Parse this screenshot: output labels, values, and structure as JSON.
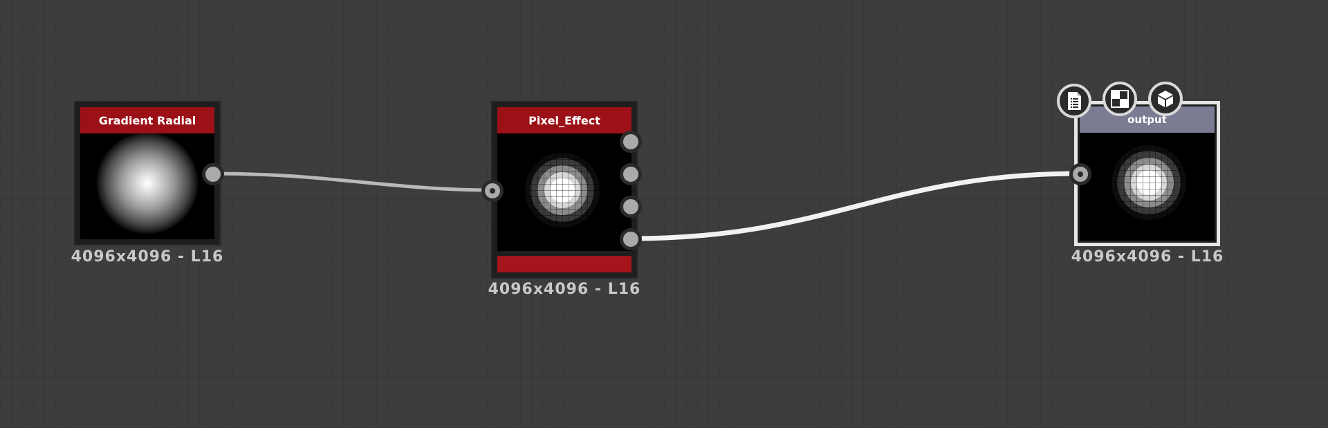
{
  "graph": {
    "nodes": [
      {
        "id": "gradient_radial",
        "title": "Gradient Radial",
        "size_label": "4096x4096 - L16",
        "header_color": "#9c1118"
      },
      {
        "id": "pixel_effect",
        "title": "Pixel_Effect",
        "size_label": "4096x4096 - L16",
        "header_color": "#9c1118"
      },
      {
        "id": "output",
        "title": "output",
        "size_label": "4096x4096 - L16",
        "header_color": "#7b7b93"
      }
    ],
    "output_toolbar": {
      "icons": [
        "document-icon",
        "checker-icon",
        "cube-icon"
      ]
    }
  }
}
